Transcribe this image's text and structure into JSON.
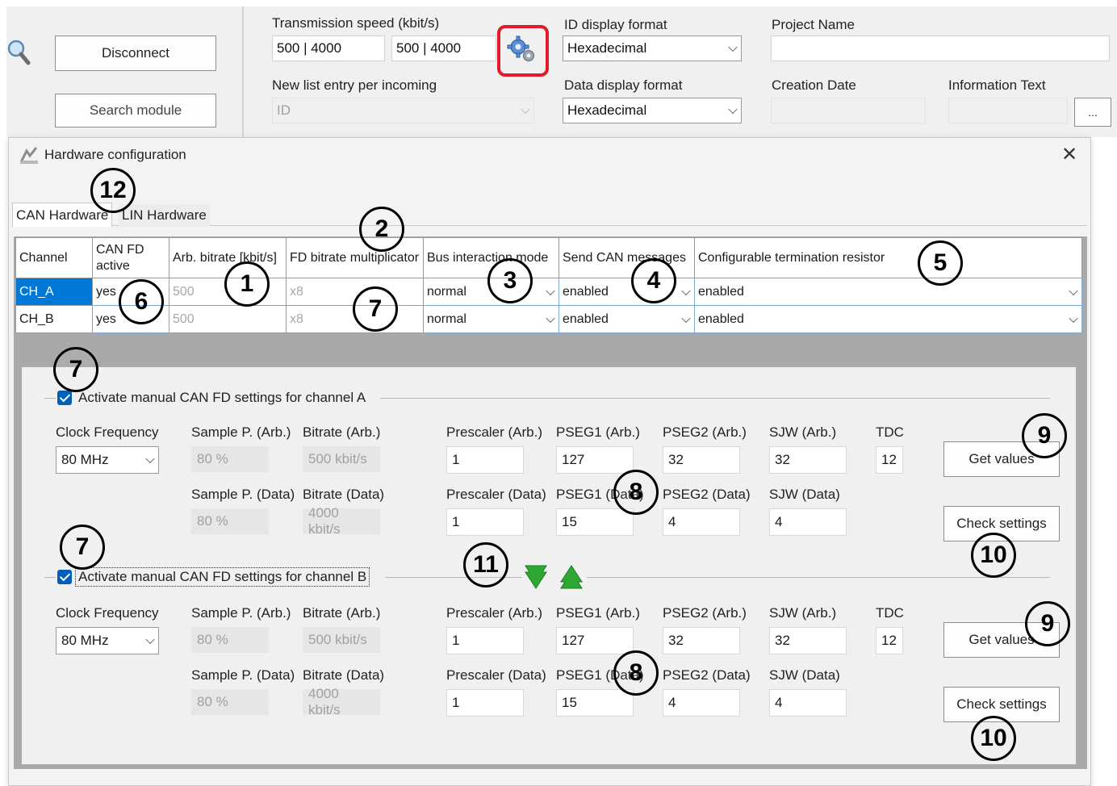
{
  "app": {
    "disconnect_label": "Disconnect",
    "search_module_label": "Search module",
    "transmission_speed_label": "Transmission speed (kbit/s)",
    "speed_a": "500 | 4000",
    "speed_b": "500 | 4000",
    "id_display_label": "ID display format",
    "id_display_value": "Hexadecimal",
    "project_name_label": "Project Name",
    "project_name_value": "",
    "new_list_entry_label": "New list entry per incoming",
    "new_list_entry_value": "ID",
    "data_display_label": "Data display format",
    "data_display_value": "Hexadecimal",
    "creation_date_label": "Creation Date",
    "creation_date_value": "",
    "info_text_label": "Information Text",
    "info_text_value": "",
    "ellipsis_label": "...",
    "highlight_color": "#e21b2a"
  },
  "dialog": {
    "title": "Hardware configuration",
    "close_glyph": "✕",
    "tabs": [
      "CAN Hardware",
      "LIN Hardware"
    ],
    "columns": [
      "Channel",
      "CAN FD active",
      "Arb. bitrate [kbit/s]",
      "FD bitrate multiplicator",
      "Bus interaction mode",
      "Send CAN messages",
      "Configurable termination resistor"
    ],
    "rows": [
      {
        "channel": "CH_A",
        "canfd": "yes",
        "arb": "500",
        "mult": "x8",
        "bus": "normal",
        "send": "enabled",
        "term": "enabled"
      },
      {
        "channel": "CH_B",
        "canfd": "yes",
        "arb": "500",
        "mult": "x8",
        "bus": "normal",
        "send": "enabled",
        "term": "enabled"
      }
    ]
  },
  "manual": {
    "group_a_label": "Activate manual CAN FD settings for channel A",
    "group_b_label": "Activate manual CAN FD settings for channel B",
    "labels": {
      "clock": "Clock Frequency",
      "sp_arb": "Sample P. (Arb.)",
      "br_arb": "Bitrate (Arb.)",
      "pre_arb": "Prescaler (Arb.)",
      "pseg1_arb": "PSEG1 (Arb.)",
      "pseg2_arb": "PSEG2 (Arb.)",
      "sjw_arb": "SJW (Arb.)",
      "tdc": "TDC",
      "sp_data": "Sample P. (Data)",
      "br_data": "Bitrate (Data)",
      "pre_data": "Prescaler (Data)",
      "pseg1_data": "PSEG1 (Data)",
      "pseg2_data": "PSEG2 (Data)",
      "sjw_data": "SJW (Data)"
    },
    "get_values_label": "Get values",
    "check_settings_label": "Check settings",
    "channels": [
      {
        "clock": "80 MHz",
        "sp_arb": "80 %",
        "br_arb": "500 kbit/s",
        "pre_arb": "1",
        "pseg1_arb": "127",
        "pseg2_arb": "32",
        "sjw_arb": "32",
        "tdc": "12",
        "sp_data": "80 %",
        "br_data": "4000 kbit/s",
        "pre_data": "1",
        "pseg1_data": "15",
        "pseg2_data": "4",
        "sjw_data": "4"
      },
      {
        "clock": "80 MHz",
        "sp_arb": "80 %",
        "br_arb": "500 kbit/s",
        "pre_arb": "1",
        "pseg1_arb": "127",
        "pseg2_arb": "32",
        "sjw_arb": "32",
        "tdc": "12",
        "sp_data": "80 %",
        "br_data": "4000 kbit/s",
        "pre_data": "1",
        "pseg1_data": "15",
        "pseg2_data": "4",
        "sjw_data": "4"
      }
    ]
  },
  "annotations": {
    "n1": "1",
    "n2": "2",
    "n3": "3",
    "n4": "4",
    "n5": "5",
    "n6": "6",
    "n7": "7",
    "n8": "8",
    "n9": "9",
    "n10": "10",
    "n11": "11",
    "n12": "12"
  }
}
